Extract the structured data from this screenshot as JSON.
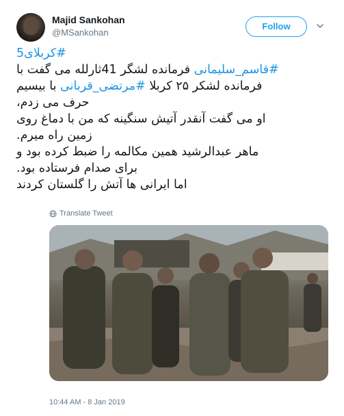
{
  "author": {
    "display_name": "Majid Sankohan",
    "handle": "@MSankohan"
  },
  "follow_button": {
    "label": "Follow"
  },
  "tweet": {
    "line1": {
      "hashtag": "#کربلای5"
    },
    "line2": {
      "hashtag": "#قاسم_سلیمانی",
      "text": " فرمانده لشگر 41ثارلله می گفت با"
    },
    "line3": {
      "pre": "فرمانده لشکر ۲۵ کربلا ",
      "hashtag": "#مرتضی_قربانی",
      "post": " با بیسیم"
    },
    "line4": "حرف می زدم،",
    "line5": "او می گفت آنقدر آتیش سنگینه که من با دماغ روی",
    "line6": "زمین راه میرم.",
    "line7": "ماهر عبدالرشید همین مکالمه را ضبط کرده بود و",
    "line8": "برای صدام فرستاده بود.",
    "line9": "اما ایرانی ها آتش را گلستان کردند"
  },
  "translate_label": "Translate Tweet",
  "timestamp": "10:44 AM - 8 Jan 2019",
  "icons": {
    "translate": "globe-icon",
    "menu": "chevron-down-icon"
  },
  "colors": {
    "accent": "#1da1f2",
    "hashtag": "#1b95e0",
    "muted": "#657786",
    "text": "#14171a"
  }
}
